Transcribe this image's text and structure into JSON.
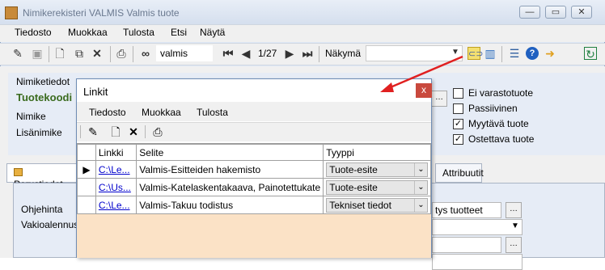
{
  "window": {
    "title": "Nimikerekisteri VALMIS Valmis tuote",
    "controls": [
      "—",
      "▭",
      "✕"
    ]
  },
  "menu": [
    "Tiedosto",
    "Muokkaa",
    "Tulosta",
    "Etsi",
    "Näytä"
  ],
  "toolbar": {
    "search_value": "valmis",
    "record_position": "1/27",
    "view_label": "Näkymä",
    "view_value": ""
  },
  "form": {
    "section_title": "Nimiketiedot",
    "code_label": "Tuotekoodi",
    "name_label": "Nimike",
    "extra_name_label": "Lisänimike",
    "checkboxes": [
      {
        "label": "Ei varastotuote",
        "checked": false
      },
      {
        "label": "Passiivinen",
        "checked": false
      },
      {
        "label": "Myytävä tuote",
        "checked": true
      },
      {
        "label": "Ostettava tuote",
        "checked": true
      }
    ]
  },
  "tabs": {
    "basic": "Perustiedot",
    "attributes": "Attribuutit"
  },
  "tab_content": {
    "guide_label": "Ohjehinta",
    "discount_label": "Vakioalennus?",
    "combo_value": "tys tuotteet"
  },
  "dialog": {
    "title": "Linkit",
    "close": "x",
    "menu": [
      "Tiedosto",
      "Muokkaa",
      "Tulosta"
    ],
    "columns": [
      "Linkki",
      "Selite",
      "Tyyppi"
    ],
    "rows": [
      {
        "link": "C:\\Le...",
        "description": "Valmis-Esitteiden hakemisto",
        "type": "Tuote-esite"
      },
      {
        "link": "C:\\Us...",
        "description": "Valmis-Katelaskentakaava, Painotettukate",
        "type": "Tuote-esite"
      },
      {
        "link": "C:\\Le...",
        "description": "Valmis-Takuu todistus",
        "type": "Tekniset tiedot"
      }
    ]
  },
  "colors": {
    "titlebar": "#dfe8f6",
    "dialog_close": "#c9493d",
    "grid_empty": "#fbe2c6",
    "arrow": "#e02020",
    "code_label": "#3a6b1e"
  },
  "icons": [
    "edit-icon",
    "save-icon",
    "new-icon",
    "copy-icon",
    "delete-icon",
    "print-icon",
    "binoculars-icon",
    "first-icon",
    "prev-icon",
    "next-icon",
    "last-icon",
    "link-icon",
    "database-icon",
    "list-icon",
    "help-icon",
    "export-icon",
    "refresh-icon"
  ]
}
